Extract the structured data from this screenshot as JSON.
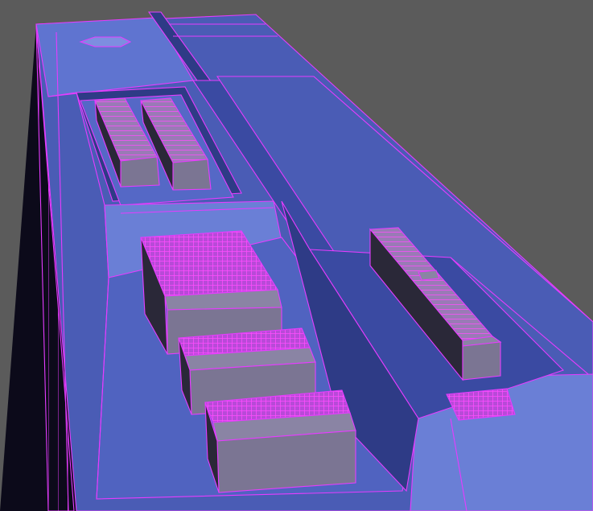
{
  "scene": {
    "description_visible_text": "",
    "colors": {
      "background": "#5b5b5b",
      "face_top": "#4a5cb5",
      "face_light": "#6a7fd6",
      "face_dark": "#2e3b86",
      "face_shadow": "#1a1f45",
      "side_black": "#0c0a1a",
      "component_gray": "#7b7593",
      "component_dark": "#2a2838",
      "wire": "#e63cff"
    }
  }
}
